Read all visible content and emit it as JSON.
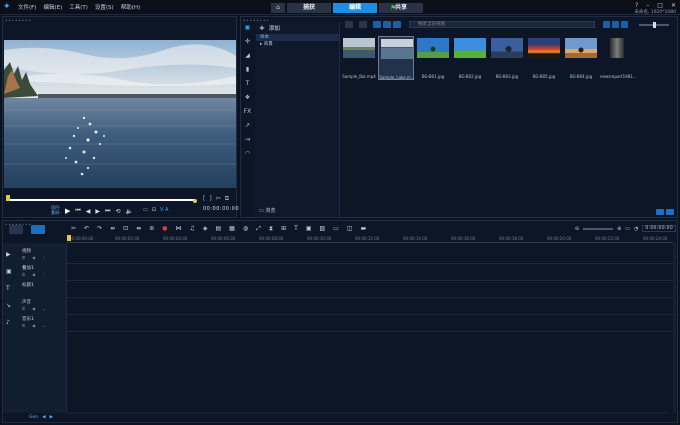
{
  "menu": [
    "文件(F)",
    "编辑(E)",
    "工具(T)",
    "设置(S)",
    "帮助(H)"
  ],
  "tabs": {
    "capture": "捕获",
    "edit": "编辑",
    "share": "共享"
  },
  "window": {
    "project_label": "未命名, 1920*1080"
  },
  "preview": {
    "mode_project": "项目-",
    "mode_clip": "素材-",
    "timecode": "00:00:00:00",
    "va_label": "V A"
  },
  "library": {
    "add_label": "添加",
    "folders": [
      "样本",
      "背景"
    ],
    "search_placeholder": "搜索当前视图",
    "browse_label": "浏览",
    "thumbnails": [
      {
        "caption": "Sample_Bal.mp4"
      },
      {
        "caption": "Sample_Lake.m..."
      },
      {
        "caption": "BG-B01.jpg"
      },
      {
        "caption": "BG-B02.jpg"
      },
      {
        "caption": "BG-B03.jpg"
      },
      {
        "caption": "BG-B05.jpg"
      },
      {
        "caption": "BG-B04.jpg"
      },
      {
        "caption": "newsreport1981..."
      }
    ]
  },
  "timeline": {
    "timecode": "0:00:00:00",
    "ruler_ticks": [
      "00:00:00:00",
      "00:00:02:00",
      "00:00:04:00",
      "00:00:06:00",
      "00:00:08:00",
      "00:00:10:00",
      "00:00:12:00",
      "00:00:14:00",
      "00:00:16:00",
      "00:00:18:00",
      "00:00:20:00",
      "00:00:22:00",
      "00:00:24:00"
    ],
    "tracks": [
      {
        "name": "视频",
        "icon": "video-track-icon"
      },
      {
        "name": "叠加1",
        "icon": "overlay-track-icon"
      },
      {
        "name": "标题1",
        "icon": "title-track-icon"
      },
      {
        "name": "声音",
        "icon": "voice-track-icon"
      },
      {
        "name": "音乐1",
        "icon": "music-track-icon"
      }
    ],
    "footer_label": "Gen"
  },
  "colors": {
    "accent": "#1b8fe6",
    "background": "#0d1626",
    "playhead": "#e2c84a"
  }
}
